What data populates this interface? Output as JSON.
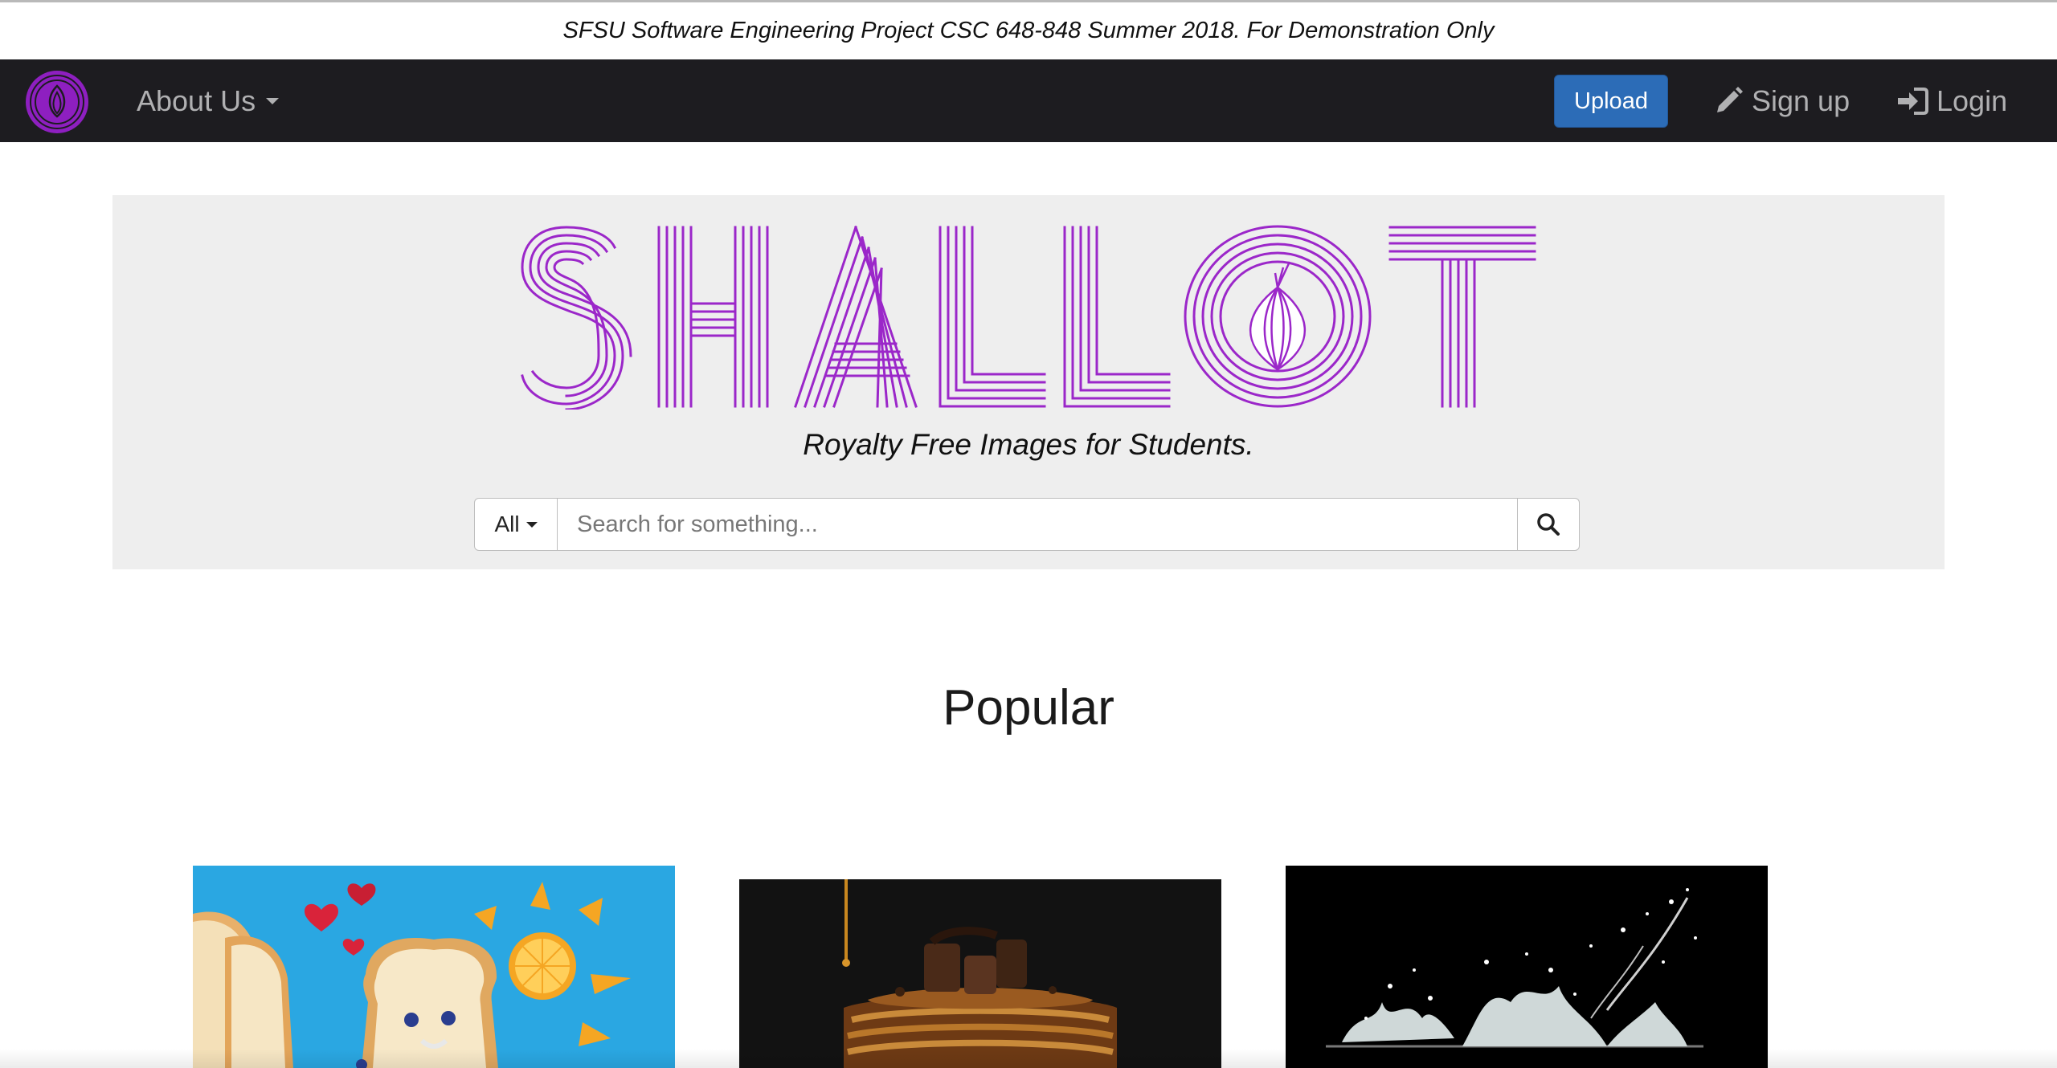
{
  "banner": {
    "text": "SFSU Software Engineering Project CSC 648-848 Summer 2018. For Demonstration Only"
  },
  "navbar": {
    "logo_icon": "shallot-onion-logo",
    "about_label": "About Us",
    "upload_label": "Upload",
    "signup_label": "Sign up",
    "signup_icon": "pencil-icon",
    "login_label": "Login",
    "login_icon": "login-arrow-icon"
  },
  "hero": {
    "logo_text": "SHALLOT",
    "tagline": "Royalty Free Images for Students.",
    "search": {
      "category": "All",
      "placeholder": "Search for something...",
      "button_icon": "search-icon"
    }
  },
  "popular": {
    "title": "Popular",
    "images": [
      {
        "subject": "bread-with-fruit-sun-icon"
      },
      {
        "subject": "pancakes-with-syrup-icon"
      },
      {
        "subject": "water-splash-icon"
      }
    ]
  },
  "colors": {
    "navbar_bg": "#1d1c20",
    "brand_purple": "#9b27c9",
    "upload_blue": "#2c6cb7",
    "jumbotron_bg": "#eeeeee"
  }
}
